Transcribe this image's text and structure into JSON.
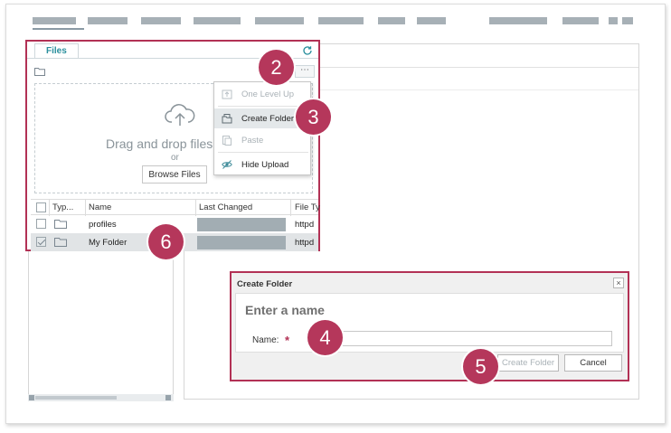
{
  "files_widget": {
    "tab_label": "Files",
    "dropzone_text": "Drag and drop files",
    "or_text": "or",
    "browse_button": "Browse Files",
    "more_glyph": "⋯",
    "table": {
      "columns": [
        "Typ...",
        "Name",
        "Last Changed",
        "File Ty"
      ],
      "rows": [
        {
          "name": "profiles",
          "file_type": "httpd",
          "checked": false,
          "selected": false
        },
        {
          "name": "My Folder",
          "file_type": "httpd",
          "checked": true,
          "selected": true
        }
      ]
    }
  },
  "context_menu": {
    "items": [
      {
        "label": "One Level Up",
        "icon": "level-up-icon",
        "disabled": true,
        "highlighted": false
      },
      {
        "label": "Create Folder",
        "icon": "create-folder-icon",
        "disabled": false,
        "highlighted": true
      },
      {
        "label": "Paste",
        "icon": "paste-icon",
        "disabled": true,
        "highlighted": false
      },
      {
        "label": "Hide Upload",
        "icon": "eye-hide-icon",
        "disabled": false,
        "highlighted": false
      }
    ]
  },
  "dialog": {
    "title": "Create Folder",
    "close_glyph": "×",
    "heading": "Enter a name",
    "name_label": "Name:",
    "required_mark": "*",
    "name_value": "",
    "create_button": "Create Folder",
    "cancel_button": "Cancel"
  },
  "callouts": [
    "2",
    "3",
    "4",
    "5",
    "6"
  ],
  "colors": {
    "accent": "#b23155",
    "badge": "#b5375b",
    "tab_text": "#2a8f9d",
    "placeholder_bar": "#a7b0b6"
  }
}
